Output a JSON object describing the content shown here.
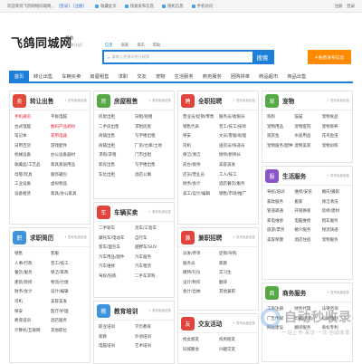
{
  "topbar": {
    "welcome": "欢迎来到飞鸽网络同城网，",
    "login": "[登录]",
    "register": "[注册]",
    "links": [
      "收藏此页",
      "快速发布信息",
      "随机信息",
      "手机访问"
    ],
    "right": [
      "注册",
      "登录"
    ]
  },
  "logo": "飞鸽同城网",
  "city": {
    "name": "总站",
    "switch": "[切换分站]"
  },
  "search": {
    "tabs": [
      "信息",
      "商家",
      "资讯",
      "帮助"
    ],
    "placeholder": "请输入关键词进行搜索",
    "button": "搜索"
  },
  "publish": "+免费发布信息",
  "nav": [
    "首页",
    "转让出售",
    "车辆买卖",
    "房屋租售",
    "求职",
    "交友",
    "宠物",
    "生活服务",
    "商务服务",
    "团购拼单",
    "商品超市",
    "商品出售"
  ],
  "cards": [
    {
      "title": "转让出售",
      "color": "#e24a3b",
      "icon": "卖",
      "pub": "+ 发布免费信息",
      "items": [
        "手机通讯",
        "平板电脑",
        "台式电脑",
        "数码产品耗材",
        "笔记本",
        "家用电器",
        "日用百货",
        "游戏配件",
        "机械设备",
        "办公设备器材",
        "收藏品/工艺品",
        "家具家居用品",
        "母婴/玩具",
        "服饰箱包",
        "工业设备",
        "虚拟物品",
        "设备租赁",
        "家具/办公家具"
      ],
      "red": [
        0,
        3,
        5
      ]
    },
    {
      "title": "房屋租售",
      "color": "#56a845",
      "icon": "房",
      "pub": "+ 发布免费信息",
      "items": [
        "房屋出租",
        "日租/短租",
        "二手房出售",
        "求租房屋",
        "商铺出售",
        "写字楼出租",
        "商铺出租",
        "厂房/仓库/土地",
        "求购/求租",
        "门市出租",
        "新房出售",
        "写字楼出售",
        "车位出租",
        "酒店公寓"
      ]
    },
    {
      "title": "全职招聘",
      "color": "#e0443c",
      "icon": "聘",
      "pub": "+ 发布免费信息",
      "items": [
        "营业员/促销/零售",
        "服务员/收银员",
        "销售代表",
        "普工/技工/技师",
        "保安",
        "文员/客服/助理",
        "司机",
        "送货员/快递员",
        "保洁/清洁",
        "厨师/厨师长",
        "前台/接待",
        "美容美发",
        "店员/营业员",
        "工人/技工",
        "财务/会计",
        "酒店餐饮/服务",
        "美工/设计/编辑",
        "销售/市场/推广"
      ]
    },
    {
      "title": "宠物",
      "color": "#56a845",
      "icon": "宠",
      "pub": "+ 发布免费信息",
      "items": [
        "狗狗",
        "猫猫",
        "宠物食品",
        "宠物用品",
        "宠物医院",
        "宠物寄养",
        "观赏鱼",
        "水族用品",
        "花鸟鱼虫",
        "宠物服务/配种",
        "宠物美容",
        "宠物训练"
      ]
    },
    {
      "title": "生活服务",
      "color": "#8a56c7",
      "icon": "服",
      "pub": "+ 发布免费信息",
      "items": [
        "驾校/培训",
        "维修/安装",
        "婚庆/摄影",
        "家政服务",
        "搬家",
        "保洁清洗",
        "管道疏通",
        "开锁换锁",
        "装修/建材",
        "家电维修",
        "电脑维修",
        "租车服务",
        "旅游/票务",
        "婚介服务",
        "物流快递",
        "美容保健",
        "酒店住宿",
        "宠物服务"
      ]
    },
    {
      "title": "求职简历",
      "color": "#3d93dc",
      "icon": "职",
      "pub": "+ 发布免费信息",
      "items": [
        "销售",
        "客服",
        "人事/行政",
        "普工/技工",
        "餐饮/服务",
        "保洁/家政",
        "建筑/装修",
        "物流/仓储",
        "财务/会计",
        "设计/编辑",
        "司机",
        "美容美发",
        "保安",
        "医疗/护理",
        "教育培训",
        "酒店服务",
        "计算机/互联网",
        "其他职位"
      ]
    },
    {
      "title": "车辆买卖",
      "color": "#e0443c",
      "icon": "车",
      "pub": "+ 发布免费信息",
      "items": [
        "二手轿车",
        "货车/工程车",
        "摩托车/电动车",
        "自行车",
        "客车/面包车",
        "越野车/SUV",
        "汽车用品/配件",
        "汽车服务",
        "汽车维修",
        "汽车租赁",
        "驾校/陪练",
        "二手车求购"
      ]
    },
    {
      "title": "兼职招聘",
      "color": "#e0443c",
      "icon": "兼",
      "pub": "+ 发布免费信息",
      "items": [
        "派发/传单",
        "促销/导购",
        "服务员",
        "家教",
        "模特/礼仪",
        "实习生",
        "设计/制作",
        "翻译",
        "会计/出纳",
        "其他兼职"
      ]
    },
    {
      "title": "商务服务",
      "color": "#56a845",
      "icon": "商",
      "pub": "+ 发布免费信息",
      "items": [
        "工商注册",
        "财务代理",
        "法律咨询",
        "广告传媒",
        "印刷/包装",
        "设计策划",
        "网站建设",
        "翻译服务",
        "商标专利"
      ]
    },
    {
      "title": "教育培训",
      "color": "#3d93dc",
      "icon": "教",
      "pub": "+ 发布免费信息",
      "items": [
        "职业培训",
        "学历教育",
        "家教",
        "外语培训",
        "电脑培训",
        "艺术培训"
      ]
    },
    {
      "title": "交友活动",
      "color": "#e0443c",
      "icon": "友",
      "pub": "+ 发布免费信息",
      "items": [
        "找女朋友",
        "找男朋友",
        "同城聚会",
        "兴趣交友"
      ]
    }
  ],
  "watermark": {
    "title": "自动秒收录",
    "sub": "一站上传·来访·一次·自动收录·"
  }
}
